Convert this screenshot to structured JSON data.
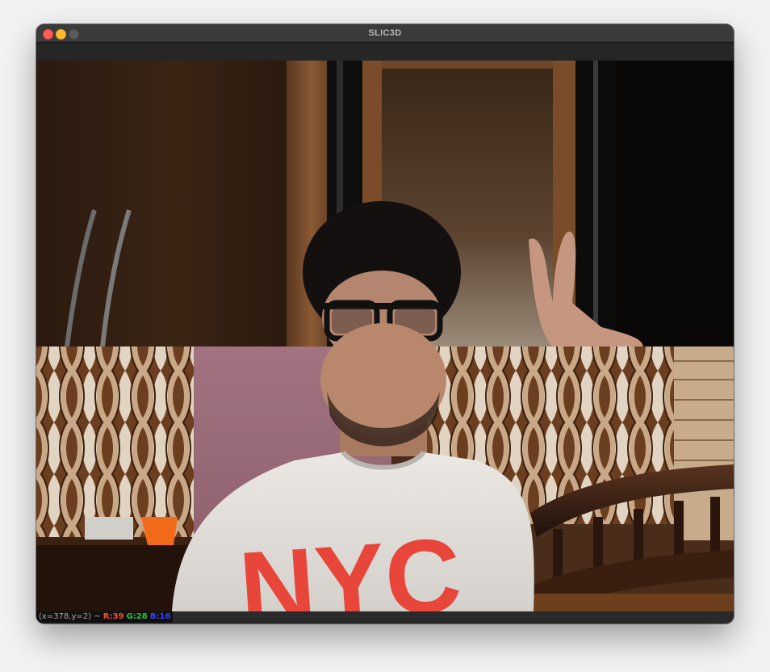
{
  "window": {
    "title": "SLIC3D",
    "controls": {
      "close": "close-button",
      "minimize": "minimize-button",
      "maximize": "maximize-button"
    }
  },
  "canvas": {
    "description_icon": "image-viewport",
    "shirt_text": "NYC"
  },
  "status": {
    "coords": "(x=378,y=2) ~",
    "r": "R:39",
    "g": "G:28",
    "b": "B:16"
  },
  "colors": {
    "close": "#ff5f57",
    "minimize": "#febc2e",
    "status_r": "#ff4b3a",
    "status_g": "#36c23a",
    "status_b": "#3d3dff"
  }
}
